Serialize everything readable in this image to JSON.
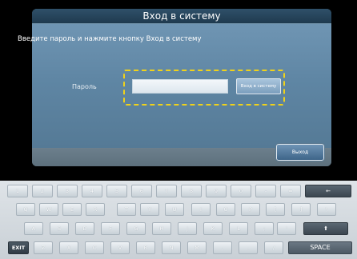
{
  "dialog": {
    "title": "Вход в систему",
    "instruction": "Введите пароль и  нажмите кнопку Вход в систему",
    "password_label": "Пароль",
    "password_value": "",
    "login_button": "Вход в систему",
    "exit_button": "Выход"
  },
  "keyboard": {
    "row1": [
      "1",
      "2",
      "3",
      "4",
      "5",
      "6",
      "7",
      "8",
      "9",
      "0",
      "-",
      "="
    ],
    "backspace_icon": "←",
    "row2": [
      "Q",
      "W",
      "E",
      "R",
      "T",
      "Y",
      "U",
      "I",
      "O",
      "P",
      "[",
      "]",
      "\\"
    ],
    "row3": [
      "A",
      "S",
      "D",
      "F",
      "G",
      "H",
      "J",
      "K",
      "L",
      ";",
      "'"
    ],
    "shift_icon": "⬆",
    "exit_key": "EXIT",
    "row4": [
      "Z",
      "X",
      "C",
      "V",
      "B",
      "N",
      "M",
      ",",
      ".",
      "/"
    ],
    "space_key": "SPACE"
  },
  "colors": {
    "focus": "#f0d21a",
    "dialog_bg": "#5f86a4",
    "header_bg": "#1f3a4f"
  }
}
